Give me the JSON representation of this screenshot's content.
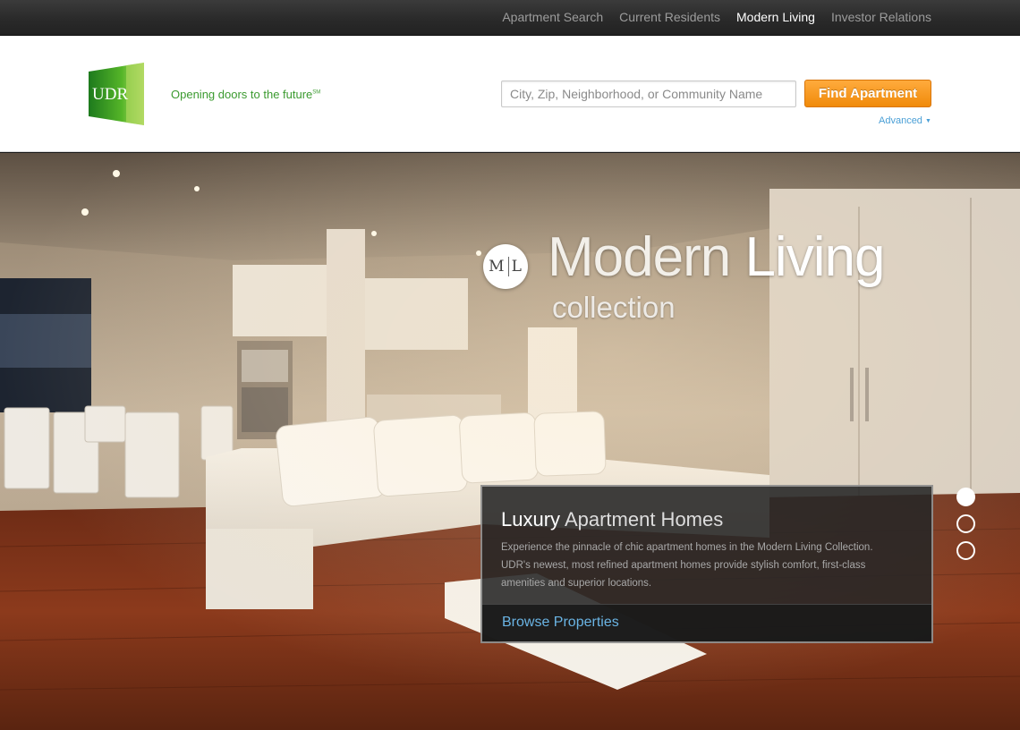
{
  "topnav": {
    "items": [
      {
        "label": "Apartment Search",
        "active": false
      },
      {
        "label": "Current Residents",
        "active": false
      },
      {
        "label": "Modern Living",
        "active": true
      },
      {
        "label": "Investor Relations",
        "active": false
      }
    ]
  },
  "header": {
    "logo_text": "UDR",
    "tagline": "Opening doors to the future",
    "tagline_mark": "SM",
    "search": {
      "placeholder": "City, Zip, Neighborhood, or Community Name",
      "value": ""
    },
    "find_button": "Find Apartment",
    "advanced_link": "Advanced"
  },
  "hero": {
    "badge_left": "M",
    "badge_right": "L",
    "title_part1": "Modern ",
    "title_part2": "Living",
    "subtitle": "collection",
    "info": {
      "title_bold": "Luxury",
      "title_rest": " Apartment Homes",
      "description": "Experience the pinnacle of chic apartment homes in the Modern Living Collection. UDR's newest, most refined apartment homes provide stylish comfort, first-class amenities and superior locations.",
      "link": "Browse Properties"
    },
    "slides": {
      "count": 3,
      "active_index": 0
    }
  },
  "colors": {
    "accent_orange": "#f08a0a",
    "brand_green": "#3b9a2f",
    "link_blue": "#6ab4e4"
  }
}
